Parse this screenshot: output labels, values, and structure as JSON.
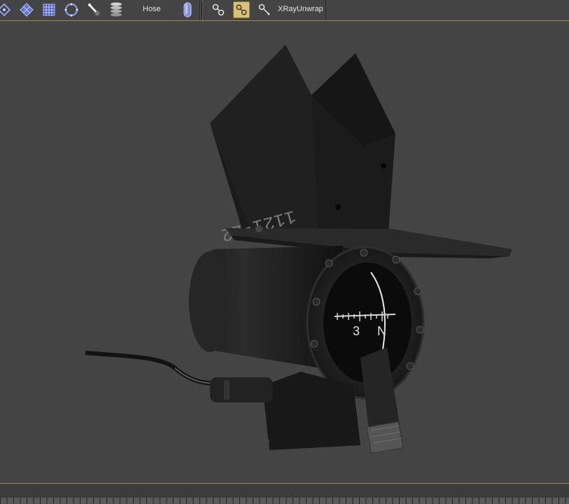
{
  "toolbar": {
    "hose_label": "Hose",
    "xray_label": "XRayUnwrap",
    "icons": [
      "vertex-select-icon",
      "polygon-select-icon",
      "grid-icon",
      "ring-icon",
      "wand-tool-icon",
      "stack-icon",
      "capsule-primitive-icon",
      "unwrap-tool-a-icon",
      "unwrap-tool-b-icon",
      "unwrap-tool-c-icon"
    ]
  },
  "viewport": {
    "object_text": "1121-22",
    "compass_number": "3",
    "compass_letter": "N"
  },
  "colors": {
    "ui_background": "#444444",
    "accent_line": "#a08a4a",
    "active_button": "#d9c277"
  }
}
